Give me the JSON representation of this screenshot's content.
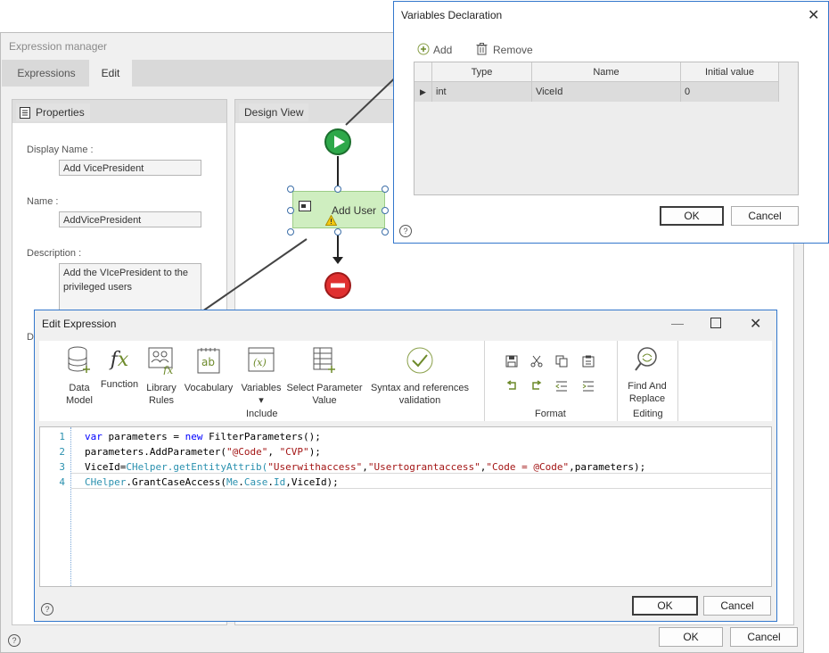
{
  "expression_manager": {
    "title": "Expression manager",
    "tabs": [
      {
        "label": "Expressions"
      },
      {
        "label": "Edit"
      }
    ],
    "properties": {
      "tab_label": "Properties",
      "display_name_label": "Display Name :",
      "display_name_value": "Add VicePresident",
      "name_label": "Name :",
      "name_value": "AddVicePresident",
      "description_label": "Description :",
      "description_value": "Add the VIcePresident to the privileged users",
      "partial_label": "D"
    },
    "design_view": {
      "tab_label": "Design View",
      "activity_label": "Add User"
    },
    "ok_label": "OK",
    "cancel_label": "Cancel"
  },
  "variables_dialog": {
    "title": "Variables Declaration",
    "add_label": "Add",
    "remove_label": "Remove",
    "columns": [
      "Type",
      "Name",
      "Initial value"
    ],
    "rows": [
      {
        "type": "int",
        "name": "ViceId",
        "initial": "0"
      }
    ],
    "ok_label": "OK",
    "cancel_label": "Cancel"
  },
  "edit_expression": {
    "title": "Edit Expression",
    "include_buttons": [
      {
        "line1": "Data",
        "line2": "Model",
        "icon": "database-icon"
      },
      {
        "line1": "Function",
        "line2": "",
        "icon": "function-icon"
      },
      {
        "line1": "Library",
        "line2": "Rules",
        "icon": "library-rules-icon"
      },
      {
        "line1": "Vocabulary",
        "line2": "",
        "icon": "vocabulary-icon"
      },
      {
        "line1": "Variables",
        "line2": "▾",
        "icon": "variables-icon"
      },
      {
        "line1": "Select Parameter",
        "line2": "Value",
        "icon": "parameter-icon"
      },
      {
        "line1": "Syntax and references",
        "line2": "validation",
        "icon": "validation-icon"
      }
    ],
    "include_group": "Include",
    "format_group": "Format",
    "editing_group": "Editing",
    "find_replace": {
      "line1": "Find And",
      "line2": "Replace"
    },
    "code_lines": [
      {
        "num": "1"
      },
      {
        "num": "2"
      },
      {
        "num": "3"
      },
      {
        "num": "4"
      }
    ],
    "code": {
      "l1_kw": "var",
      "l1_rest": " parameters = ",
      "l1_kw2": "new",
      "l1_end": " FilterParameters();",
      "l2_start": "parameters.AddParameter(",
      "l2_s1": "\"@Code\"",
      "l2_mid": ", ",
      "l2_s2": "\"CVP\"",
      "l2_end": ");",
      "l3_start": "ViceId=",
      "l3_ty": "CHelper.getEntityAttrib(",
      "l3_s1": "\"Userwithaccess\"",
      "l3_c1": ",",
      "l3_s2": "\"Usertograntaccess\"",
      "l3_c2": ",",
      "l3_s3": "\"Code = @Code\"",
      "l3_end": ",parameters);",
      "l4_ty": "CHelper",
      "l4_a": ".GrantCaseAccess(",
      "l4_ty2": "Me",
      "l4_b": ".",
      "l4_ty3": "Case",
      "l4_c": ".",
      "l4_ty4": "Id",
      "l4_end": ",ViceId);"
    },
    "ok_label": "OK",
    "cancel_label": "Cancel"
  }
}
